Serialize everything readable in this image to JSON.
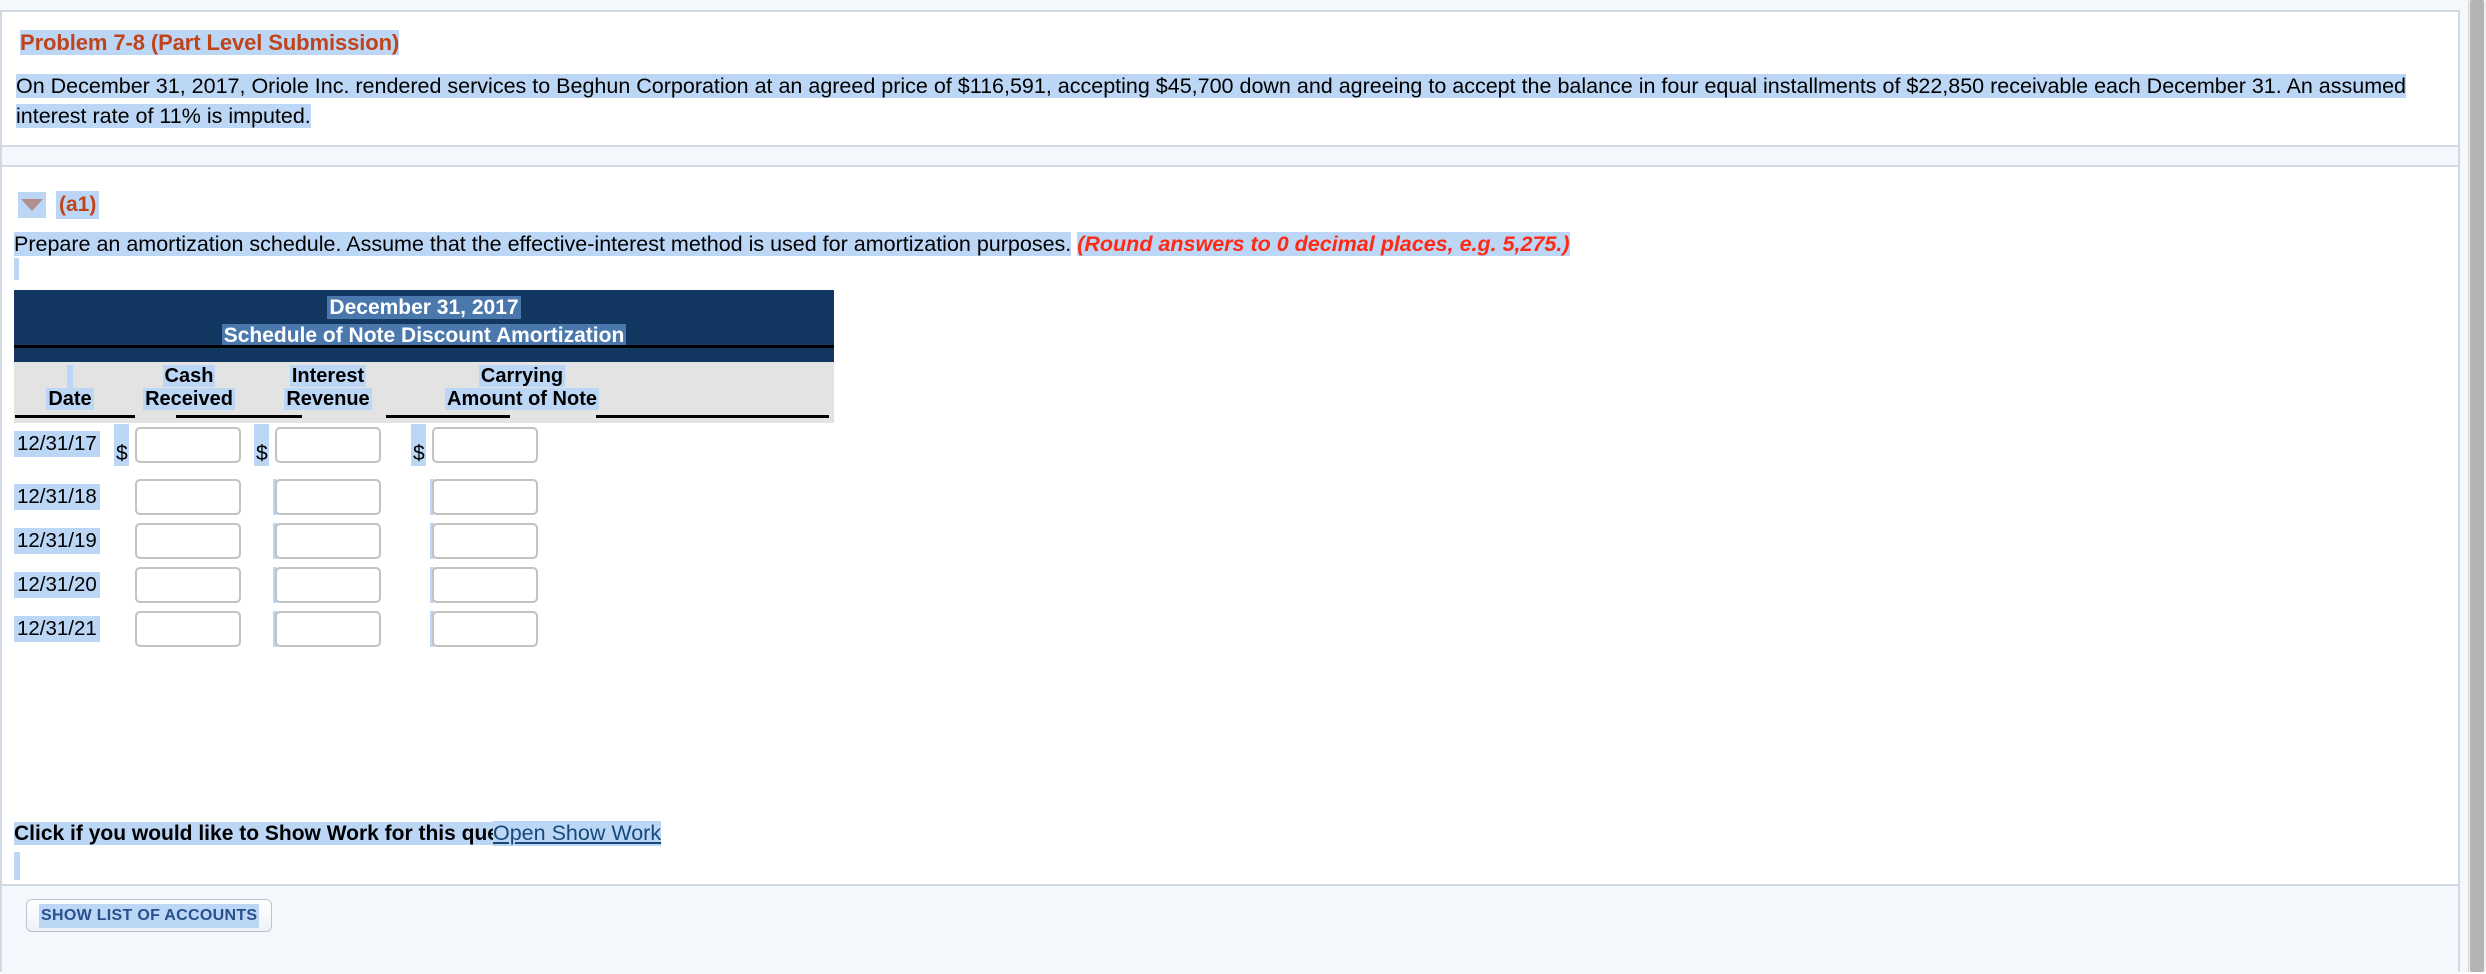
{
  "problem": {
    "title": "Problem 7-8 (Part Level Submission)",
    "text": "On December 31, 2017, Oriole Inc. rendered services to Beghun Corporation at an agreed price of $116,591, accepting $45,700 down and agreeing to accept the balance in four equal installments of $22,850 receivable each December 31. An assumed interest rate of 11% is imputed."
  },
  "part": {
    "toggle_icon": "triangle-down-icon",
    "label": "(a1)",
    "instruction": "Prepare an amortization schedule. Assume that the effective-interest method is used for amortization purposes.",
    "round_note": "(Round answers to 0 decimal places, e.g. 5,275.)"
  },
  "schedule": {
    "title_line1": "December 31, 2017",
    "title_line2": "Schedule of Note Discount Amortization",
    "columns": [
      {
        "line1": "",
        "line2": "Date"
      },
      {
        "line1": "Cash",
        "line2": "Received"
      },
      {
        "line1": "Interest",
        "line2": "Revenue"
      },
      {
        "line1": "Carrying",
        "line2": "Amount of Note"
      }
    ],
    "rows": [
      {
        "date": "12/31/17",
        "cash": "",
        "interest": "",
        "carrying": "",
        "currency": "$"
      },
      {
        "date": "12/31/18",
        "cash": "",
        "interest": "",
        "carrying": "",
        "currency": ""
      },
      {
        "date": "12/31/19",
        "cash": "",
        "interest": "",
        "carrying": "",
        "currency": ""
      },
      {
        "date": "12/31/20",
        "cash": "",
        "interest": "",
        "carrying": "",
        "currency": ""
      },
      {
        "date": "12/31/21",
        "cash": "",
        "interest": "",
        "carrying": "",
        "currency": ""
      }
    ]
  },
  "show_work": {
    "prompt": "Click if you would like to Show Work for this question:",
    "link": "Open Show Work"
  },
  "footer": {
    "accounts_button": "SHOW LIST OF ACCOUNTS"
  },
  "colors": {
    "title": "#c0441b",
    "header_band": "#123761",
    "selection": "#bcd6f5",
    "round_note": "#ff2a15",
    "link": "#15497a"
  }
}
